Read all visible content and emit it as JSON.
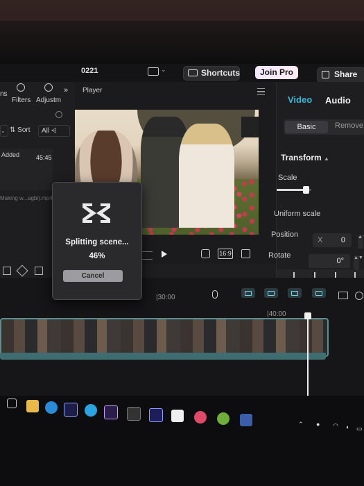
{
  "header": {
    "project_name": "0221",
    "shortcuts_label": "Shortcuts",
    "join_pro_label": "Join Pro",
    "share_label": "Share"
  },
  "left_panel": {
    "tabs": [
      {
        "label": "ns"
      },
      {
        "label": "Filters"
      },
      {
        "label": "Adjustm"
      }
    ],
    "sort_label": "Sort",
    "filter_label": "All",
    "added_label": "Added",
    "media_duration": "45:45",
    "media_filename": "Making w...agbi).mp4"
  },
  "player": {
    "title": "Player",
    "ratio_label": "16:9"
  },
  "dialog": {
    "message": "Splitting scene...",
    "progress": "46%",
    "progress_value": 0.46,
    "cancel_label": "Cancel"
  },
  "right_panel": {
    "tabs": [
      {
        "label": "Video",
        "active": true
      },
      {
        "label": "Audio",
        "active": false
      }
    ],
    "segment": {
      "basic": "Basic",
      "remove": "Remove"
    },
    "section_title": "Transform",
    "scale_label": "Scale",
    "uniform_scale_label": "Uniform scale",
    "position_label": "Position",
    "position_x_prefix": "X",
    "position_x_value": "0",
    "rotate_label": "Rotate",
    "rotate_value": "0°"
  },
  "timeline": {
    "ticks": [
      "|30:00",
      "|40:00"
    ]
  },
  "colors": {
    "accent": "#3ab7d6",
    "track_border": "#5b8f93"
  },
  "icons": [
    "layout-icon",
    "keyboard-icon",
    "share-icon",
    "filters-icon",
    "adjustments-icon",
    "refresh-icon",
    "menu-icon",
    "play-icon",
    "capcut-logo-icon",
    "microphone-icon",
    "fullscreen-icon"
  ]
}
